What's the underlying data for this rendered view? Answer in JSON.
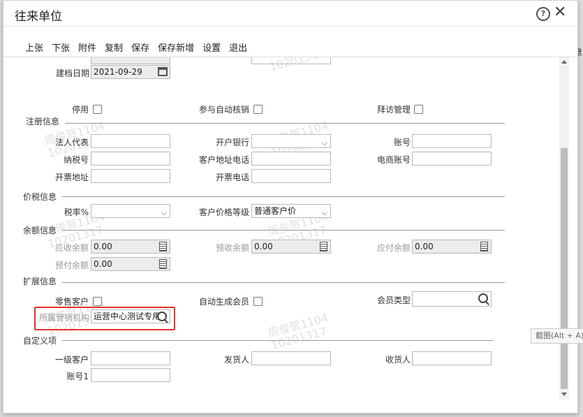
{
  "dialog": {
    "title": "往来单位",
    "help_glyph": "?",
    "close_glyph": "✕"
  },
  "background": {
    "right_text": "意"
  },
  "toolbar": [
    "上张",
    "下张",
    "附件",
    "复制",
    "保存",
    "保存新增",
    "设置",
    "退出"
  ],
  "basic": {
    "create_date_label": "建档日期",
    "create_date_value": "2021-09-29",
    "disabled_label": "停用",
    "auto_verify_label": "参与自动核销",
    "visit_mgmt_label": "拜访管理"
  },
  "sections": {
    "register": "注册信息",
    "price_tax": "价税信息",
    "balance": "余额信息",
    "extended": "扩展信息",
    "custom": "自定义项"
  },
  "register": {
    "legal_rep": "法人代表",
    "bank": "开户银行",
    "account": "账号",
    "tax_no": "纳税号",
    "addr_phone": "客户地址电话",
    "ecom_account": "电商账号",
    "invoice_addr": "开票地址",
    "invoice_phone": "开票电话"
  },
  "price_tax": {
    "tax_rate_label": "税率%",
    "price_level_label": "客户价格等级",
    "price_level_value": "普通客户价"
  },
  "balance": {
    "receivable_label": "应收余额",
    "receivable_value": "0.00",
    "pre_receive_label": "预收余额",
    "pre_receive_value": "0.00",
    "payable_label": "应付余额",
    "payable_value": "0.00",
    "prepay_label": "预付余额",
    "prepay_value": "0.00"
  },
  "extended": {
    "retail_label": "零售客户",
    "auto_member_label": "自动生成会员",
    "member_type_label": "会员类型",
    "sales_org_label": "所属营销机构",
    "sales_org_value": "运营中心测试专用"
  },
  "custom": {
    "level1_label": "一级客户",
    "shipper_label": "发货人",
    "receiver_label": "收货人",
    "account1_label": "账号1"
  },
  "watermark": {
    "name": "周俊贺1104",
    "id": "10201317"
  },
  "tooltip": "截图(Alt + A)"
}
